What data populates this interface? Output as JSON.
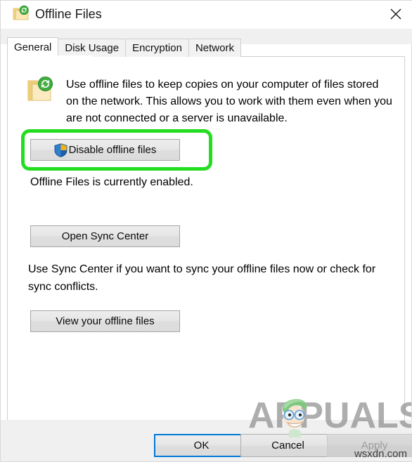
{
  "window": {
    "title": "Offline Files",
    "title_icon": "offline-folder-sync-icon",
    "close_label": "✕"
  },
  "tabs": [
    {
      "label": "General",
      "active": true
    },
    {
      "label": "Disk Usage",
      "active": false
    },
    {
      "label": "Encryption",
      "active": false
    },
    {
      "label": "Network",
      "active": false
    }
  ],
  "general": {
    "description_icon": "offline-folder-sync-icon",
    "description": "Use offline files to keep copies on your computer of files stored on the network.  This allows you to work with them even when you are not connected or a server is unavailable.",
    "disable_button": {
      "label": "Disable offline files",
      "icon": "uac-shield-icon",
      "highlighted": true
    },
    "status_text": "Offline Files is currently enabled.",
    "open_sync_center_button": "Open Sync Center",
    "sync_help_text": "Use Sync Center if you want to sync your offline files now or check for sync conflicts.",
    "view_offline_files_button": "View your offline files"
  },
  "footer": {
    "ok_label": "OK",
    "cancel_label": "Cancel",
    "apply_label": "Apply",
    "apply_disabled": true
  },
  "watermark": {
    "brand_text": "APPUALS",
    "source_text": "wsxdn.com"
  },
  "colors": {
    "highlight_green": "#25dd20",
    "focus_blue": "#0078d7",
    "folder_yellow": "#fbe09a",
    "sync_green": "#3aa93a",
    "shield_blue": "#1f6fc4",
    "shield_yellow": "#f3b118",
    "watermark_gray": "#8c8c8c",
    "brand_green": "#7ec87e"
  }
}
